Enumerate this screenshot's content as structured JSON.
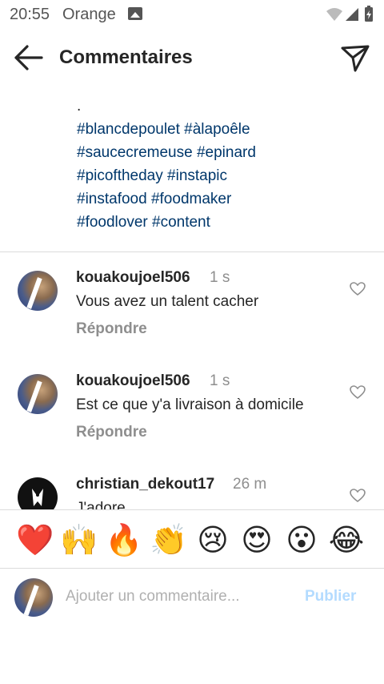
{
  "status_bar": {
    "time": "20:55",
    "carrier": "Orange"
  },
  "header": {
    "title": "Commentaires",
    "back_icon": "arrow-left-icon",
    "send_icon": "paper-plane-icon"
  },
  "caption": {
    "dot": ".",
    "hashtag_lines": [
      "#blancdepoulet #àlapoêle",
      "#saucecremeuse #epinard",
      "#picoftheday #instapic",
      "#instafood #foodmaker",
      "#foodlover #content"
    ]
  },
  "comments": [
    {
      "user": "kouakoujoel506",
      "time": "1 s",
      "text": "Vous avez un talent cacher",
      "reply": "Répondre"
    },
    {
      "user": "kouakoujoel506",
      "time": "1 s",
      "text": "Est ce que y'a livraison à domicile",
      "reply": "Répondre"
    },
    {
      "user": "christian_dekout17",
      "time": "26 m",
      "text": "J'adore",
      "reply": ""
    }
  ],
  "emoji_reactions": [
    "❤️",
    "🙌",
    "🔥",
    "👏",
    "😢",
    "😍",
    "😮",
    "😂"
  ],
  "composer": {
    "placeholder": "Ajouter un commentaire...",
    "publish_label": "Publier"
  },
  "colors": {
    "hashtag": "#00376b",
    "muted": "#8e8e8e",
    "publish_disabled": "#b3dbff"
  }
}
